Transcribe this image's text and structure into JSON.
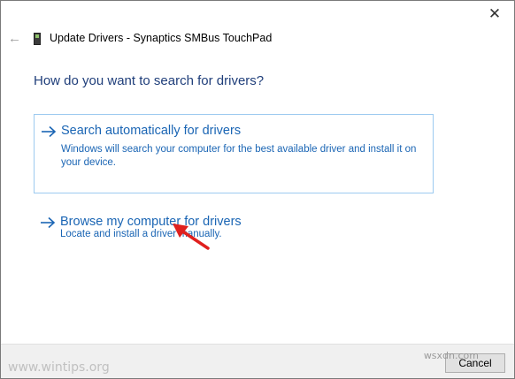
{
  "window": {
    "title": "Update Drivers - Synaptics SMBus TouchPad",
    "close_glyph": "✕",
    "back_glyph": "←"
  },
  "main": {
    "heading": "How do you want to search for drivers?",
    "options": [
      {
        "title": "Search automatically for drivers",
        "description": "Windows will search your computer for the best available driver and install it on your device."
      },
      {
        "title": "Browse my computer for drivers",
        "description": "Locate and install a driver manually."
      }
    ]
  },
  "footer": {
    "cancel_label": "Cancel"
  },
  "watermarks": {
    "left": "www.wintips.org",
    "right": "wsxdn.com"
  },
  "colors": {
    "link": "#1a65b4",
    "heading": "#1f3e7a",
    "highlight_border": "#9ccaf0",
    "annotation_arrow": "#e0201e"
  },
  "icons": {
    "back": "back-arrow-icon",
    "device": "touchpad-device-icon",
    "option_arrow": "right-arrow-icon",
    "close": "close-icon"
  }
}
